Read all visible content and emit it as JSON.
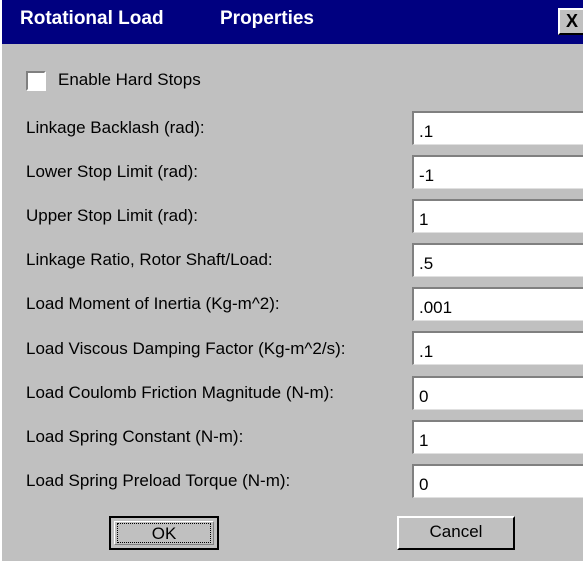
{
  "window": {
    "title_part1": "Rotational Load",
    "title_part2": "Properties",
    "close_glyph": "X"
  },
  "checkbox": {
    "label": "Enable Hard Stops",
    "checked": false
  },
  "rows": [
    {
      "label": "Linkage Backlash  (rad):",
      "value": ".1"
    },
    {
      "label": "Lower Stop Limit (rad):",
      "value": "-1"
    },
    {
      "label": "Upper Stop Limit (rad):",
      "value": "1"
    },
    {
      "label": "Linkage Ratio, Rotor Shaft/Load:",
      "value": ".5"
    },
    {
      "label": "Load Moment of Inertia (Kg-m^2):",
      "value": ".001"
    },
    {
      "label": "Load Viscous Damping Factor (Kg-m^2/s):",
      "value": ".1"
    },
    {
      "label": "Load Coulomb Friction Magnitude (N-m):",
      "value": "0"
    },
    {
      "label": "Load Spring Constant (N-m):",
      "value": "1"
    },
    {
      "label": "Load Spring Preload Torque (N-m):",
      "value": "0"
    }
  ],
  "buttons": {
    "ok": "OK",
    "cancel": "Cancel"
  }
}
